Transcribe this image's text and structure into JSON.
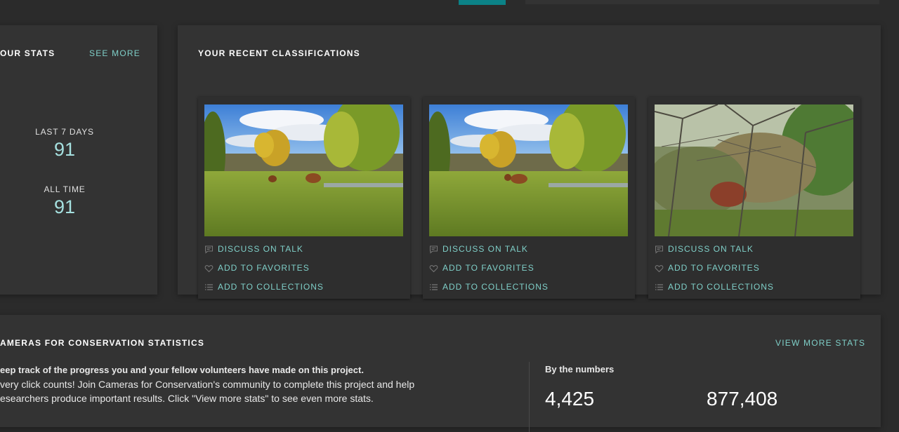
{
  "stats": {
    "title": "OUR STATS",
    "see_more": "SEE MORE",
    "last7_label": "LAST 7 DAYS",
    "last7_value": "91",
    "alltime_label": "ALL TIME",
    "alltime_value": "91"
  },
  "recent": {
    "title": "YOUR RECENT CLASSIFICATIONS",
    "actions": {
      "discuss": "DISCUSS ON TALK",
      "favorite": "ADD TO FAVORITES",
      "collect": "ADD TO COLLECTIONS"
    }
  },
  "project": {
    "title": "AMERAS FOR CONSERVATION STATISTICS",
    "view_more": "VIEW MORE STATS",
    "desc_line1": "eep track of the progress you and your fellow volunteers have made on this project.",
    "desc_line2": "very click counts! Join Cameras for Conservation's community to complete this project and help",
    "desc_line3": "esearchers produce important results. Click \"View more stats\" to see even more stats.",
    "numbers_label": "By the numbers",
    "number1": "4,425",
    "number2": "877,408"
  },
  "colors": {
    "background": "#2b2b2b",
    "panel": "#333333",
    "accent": "#7fcfc8",
    "stat_value": "#a5e0df",
    "top_button": "#0b8287"
  },
  "icons": {
    "discuss": "speech-bubble-icon",
    "favorite": "heart-icon",
    "collect": "list-icon"
  }
}
